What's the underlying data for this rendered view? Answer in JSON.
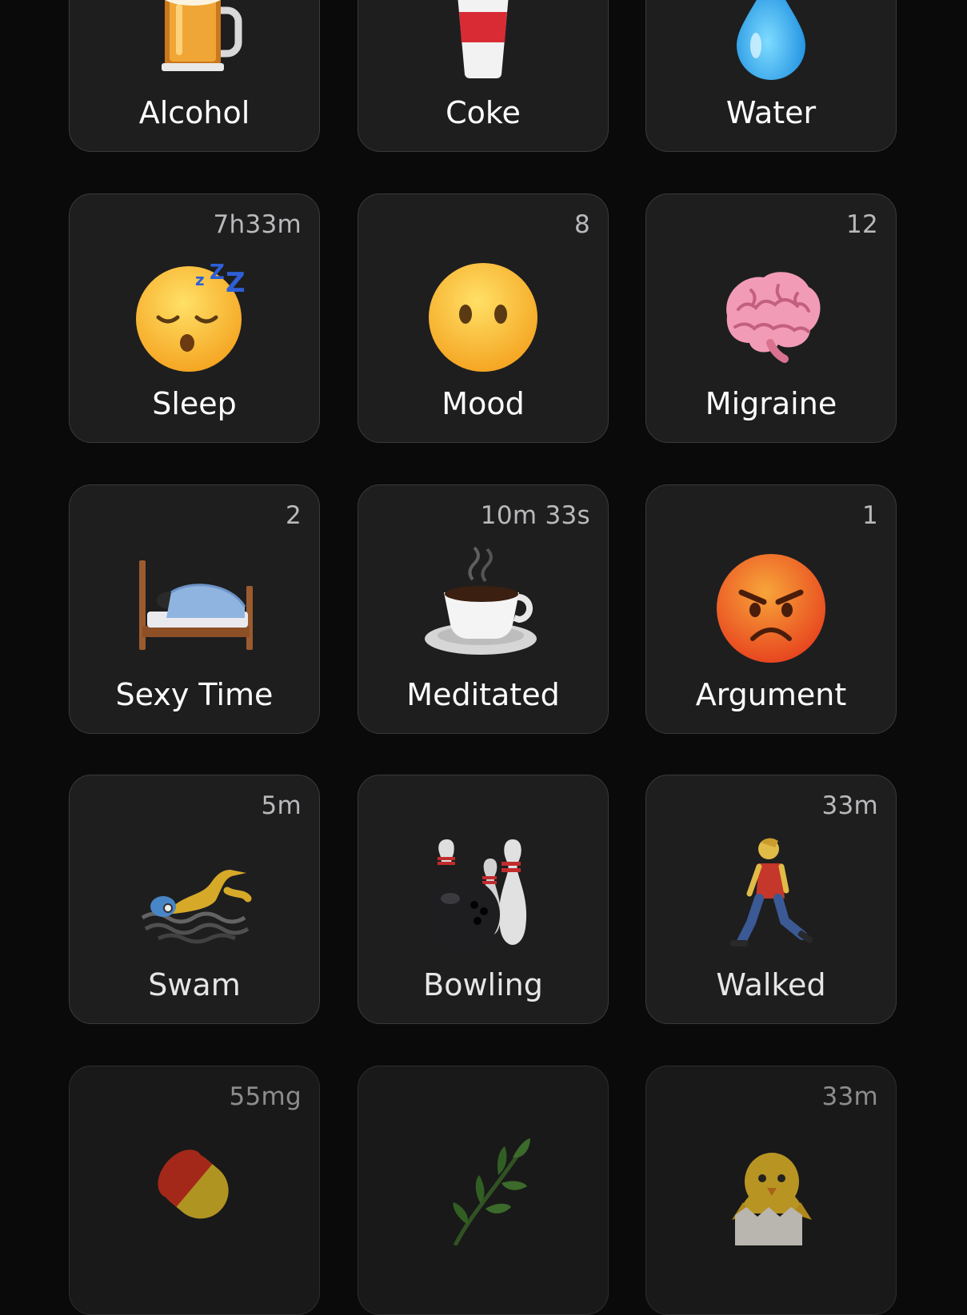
{
  "tiles": [
    {
      "label": "Alcohol",
      "value": "",
      "icon": "beer-mug-icon"
    },
    {
      "label": "Coke",
      "value": "",
      "icon": "soda-cup-icon"
    },
    {
      "label": "Water",
      "value": "",
      "icon": "water-drop-icon"
    },
    {
      "label": "Sleep",
      "value": "7h33m",
      "icon": "sleeping-face-icon"
    },
    {
      "label": "Mood",
      "value": "8",
      "icon": "neutral-face-icon"
    },
    {
      "label": "Migraine",
      "value": "12",
      "icon": "brain-icon"
    },
    {
      "label": "Sexy Time",
      "value": "2",
      "icon": "bed-icon"
    },
    {
      "label": "Meditated",
      "value": "10m 33s",
      "icon": "hot-coffee-icon"
    },
    {
      "label": "Argument",
      "value": "1",
      "icon": "angry-face-icon"
    },
    {
      "label": "Swam",
      "value": "5m",
      "icon": "swimmer-icon"
    },
    {
      "label": "Bowling",
      "value": "",
      "icon": "bowling-icon"
    },
    {
      "label": "Walked",
      "value": "33m",
      "icon": "walking-person-icon"
    },
    {
      "label": "",
      "value": "55mg",
      "icon": "pill-icon"
    },
    {
      "label": "",
      "value": "",
      "icon": "herb-icon"
    },
    {
      "label": "",
      "value": "33m",
      "icon": "hatching-chick-icon"
    }
  ],
  "colors": {
    "background": "#0a0a0a",
    "tile_background": "#1e1e1f",
    "tile_border": "#3a3a3c",
    "value_text": "#b9b9bc",
    "label_text": "#ffffff"
  }
}
